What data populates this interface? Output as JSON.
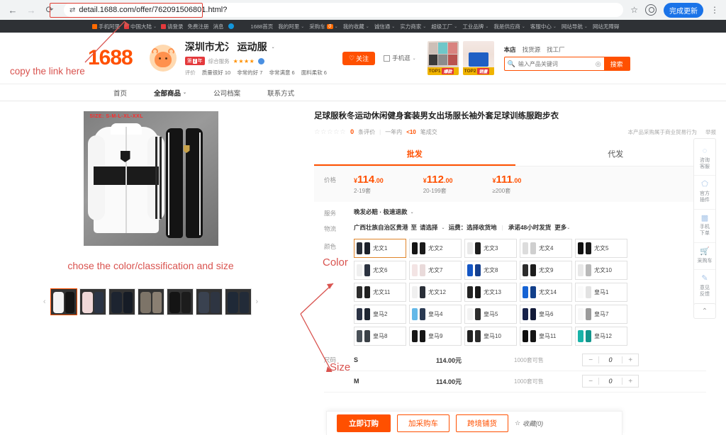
{
  "browser": {
    "back_icon": "←",
    "forward_icon": "→",
    "reload_icon": "⟳",
    "site_icon": "page-info-icon",
    "url": "detail.1688.com/offer/762091506801.html?",
    "bookmark_icon": "☆",
    "profile_icon": "avatar-icon",
    "update_label": "完成更新",
    "menu_icon": "⋮"
  },
  "topnav": {
    "left": [
      {
        "label": "手机阿里",
        "icon": "square-orange"
      },
      {
        "label": "中国大陆",
        "icon": "flag-cn",
        "caret": "⌄"
      },
      {
        "label": "请登录",
        "icon": "square-red"
      },
      {
        "label": "免费注册"
      },
      {
        "label": "消息"
      },
      {
        "label": "",
        "icon": "dot-blue"
      }
    ],
    "right": [
      {
        "label": "1688首页"
      },
      {
        "label": "我的阿里",
        "caret": "⌄"
      },
      {
        "label": "采购车",
        "badge": "0",
        "caret": "⌄"
      },
      {
        "label": "我的收藏",
        "caret": "⌄"
      },
      {
        "label": "诚信通",
        "caret": "⌄"
      },
      {
        "label": "实力商家",
        "caret": "⌄"
      },
      {
        "label": "超级工厂",
        "caret": "⌄"
      },
      {
        "label": "工业品牌",
        "caret": "⌄"
      },
      {
        "label": "我是供应商",
        "caret": "⌄"
      },
      {
        "label": "客服中心",
        "caret": "⌄"
      },
      {
        "label": "网站导航",
        "caret": "⌄"
      },
      {
        "label": "网站无障碍"
      }
    ]
  },
  "shop": {
    "logo": "1688",
    "name": "深圳市尤文运动服",
    "name_blurred": "深圳市尤氵  运动服",
    "dropdown_caret": "⌄",
    "badge_year_prefix": "第",
    "badge_year_num": "1",
    "badge_year_suffix": "年",
    "service_label": "综合服务",
    "stars": "★★★★",
    "star_partial": "★",
    "cert_icon": "verified-badge",
    "tags": [
      {
        "key": "评价",
        "value": ""
      },
      {
        "key": "",
        "value": "质量很好 10"
      },
      {
        "key": "",
        "value": "非常的好 7"
      },
      {
        "key": "",
        "value": "非常满意 6"
      },
      {
        "key": "",
        "value": "面料柔软 6"
      }
    ],
    "follow_label": "关注",
    "follow_icon": "♡",
    "mobile_label": "手机逛",
    "mobile_caret": "⌄",
    "promo_cards": [
      {
        "rank": "TOP1",
        "tag": "爆款"
      },
      {
        "rank": "TOP2",
        "tag": "销量"
      }
    ]
  },
  "search": {
    "tabs": [
      "本店",
      "找货源",
      "找工厂"
    ],
    "active_tab": "本店",
    "placeholder": "输入产品关键词",
    "value": "",
    "camera_icon": "camera-icon",
    "button_label": "搜索"
  },
  "shop_nav": {
    "items": [
      {
        "label": "首页",
        "active": false
      },
      {
        "label": "全部商品",
        "active": true,
        "caret": "⌄"
      },
      {
        "label": "公司档案",
        "active": false
      },
      {
        "label": "联系方式",
        "active": false
      }
    ]
  },
  "gallery": {
    "size_overlay": "SIZE: S-M-L-XL-XXL",
    "prev_icon": "‹",
    "next_icon": "›",
    "thumbs": [
      {
        "name": "thumb-1",
        "jacket": "#f4f4f4",
        "pants": "#1a1a1a",
        "selected": true
      },
      {
        "name": "thumb-2",
        "jacket": "#f0d8d8",
        "pants": "#2b3445",
        "selected": false
      },
      {
        "name": "thumb-3",
        "jacket": "#1d2430",
        "pants": "#161c26",
        "selected": false
      },
      {
        "name": "thumb-4",
        "jacket": "#7d7468",
        "pants": "#8a7f72",
        "selected": false
      },
      {
        "name": "thumb-5",
        "jacket": "#141414",
        "pants": "#1c1c1c",
        "selected": false
      },
      {
        "name": "thumb-6",
        "jacket": "#3a4250",
        "pants": "#2e3542",
        "selected": false
      },
      {
        "name": "thumb-7",
        "jacket": "#1f2937",
        "pants": "#222b38",
        "selected": false
      }
    ]
  },
  "product": {
    "title": "足球服秋冬运动休闲健身套装男女出场服长袖外套足球训练服跑步衣",
    "stars": "☆☆☆☆☆",
    "review_count": "0",
    "review_unit": "条评价",
    "period": "一年内",
    "deal_count": "<10",
    "deal_unit": "笔成交",
    "notice": "本产品采购属于商业贸易行为",
    "report": "举报"
  },
  "tabs": {
    "items": [
      {
        "label": "批发",
        "active": true
      },
      {
        "label": "代发",
        "active": false
      }
    ]
  },
  "price": {
    "label": "价格",
    "tiers": [
      {
        "currency": "¥",
        "amount": "114",
        "cents": ".00",
        "qty": "2-19套"
      },
      {
        "currency": "¥",
        "amount": "112",
        "cents": ".00",
        "qty": "20-199套"
      },
      {
        "currency": "¥",
        "amount": "111",
        "cents": ".00",
        "qty": "≥200套"
      }
    ]
  },
  "service": {
    "label": "服务",
    "value": "晚发必赔 · 极速退款",
    "caret": "⌄"
  },
  "logistics": {
    "label": "物流",
    "origin": "广西壮族自治区贵港",
    "to_label": "至",
    "dest_placeholder": "请选择",
    "caret": "⌄",
    "freight": "运费：选择收货地",
    "promise": "承诺48小时发货",
    "more": "更多",
    "more_caret": "⌄"
  },
  "color": {
    "label": "颜色",
    "annotation": "Color",
    "options": [
      {
        "name": "尤文1",
        "jacket": "#2a2f38",
        "pants": "#1b2029",
        "selected": true
      },
      {
        "name": "尤文2",
        "jacket": "#141414",
        "pants": "#1a1a1a",
        "selected": false
      },
      {
        "name": "尤文3",
        "jacket": "#e9e9e9",
        "pants": "#1e1e1e",
        "selected": false
      },
      {
        "name": "尤文4",
        "jacket": "#dcdcdc",
        "pants": "#cfcfcf",
        "selected": false
      },
      {
        "name": "尤文5",
        "jacket": "#101010",
        "pants": "#191919",
        "selected": false
      },
      {
        "name": "尤文6",
        "jacket": "#efefef",
        "pants": "#2c3340",
        "selected": false
      },
      {
        "name": "尤文7",
        "jacket": "#f3e4e4",
        "pants": "#e9dada",
        "selected": false
      },
      {
        "name": "尤文8",
        "jacket": "#1456c4",
        "pants": "#15408f",
        "selected": false
      },
      {
        "name": "尤文9",
        "jacket": "#2b2b2b",
        "pants": "#1d1d1d",
        "selected": false
      },
      {
        "name": "尤文10",
        "jacket": "#e8e8e8",
        "pants": "#b9b9b9",
        "selected": false
      },
      {
        "name": "尤文11",
        "jacket": "#2c2c2c",
        "pants": "#1f1f1f",
        "selected": false
      },
      {
        "name": "尤文12",
        "jacket": "#f0f0f0",
        "pants": "#2a2f38",
        "selected": false
      },
      {
        "name": "尤文13",
        "jacket": "#232323",
        "pants": "#191919",
        "selected": false
      },
      {
        "name": "尤文14",
        "jacket": "#1663d4",
        "pants": "#123f8a",
        "selected": false
      },
      {
        "name": "皇马1",
        "jacket": "#fafafa",
        "pants": "#e2e2e2",
        "selected": false
      },
      {
        "name": "皇马2",
        "jacket": "#2b3344",
        "pants": "#1e2531",
        "selected": false
      },
      {
        "name": "皇马4",
        "jacket": "#63b8e8",
        "pants": "#2a3a52",
        "selected": false
      },
      {
        "name": "皇马5",
        "jacket": "#f2f2f2",
        "pants": "#2d2d2d",
        "selected": false
      },
      {
        "name": "皇马6",
        "jacket": "#17224a",
        "pants": "#121a38",
        "selected": false
      },
      {
        "name": "皇马7",
        "jacket": "#f7f7f7",
        "pants": "#9a9a9a",
        "selected": false
      },
      {
        "name": "皇马8",
        "jacket": "#4a5158",
        "pants": "#3a4046",
        "selected": false
      },
      {
        "name": "皇马9",
        "jacket": "#171717",
        "pants": "#141414",
        "selected": false
      },
      {
        "name": "皇马10",
        "jacket": "#222222",
        "pants": "#2b2b2b",
        "selected": false
      },
      {
        "name": "皇马11",
        "jacket": "#0e0e0e",
        "pants": "#151515",
        "selected": false
      },
      {
        "name": "皇马12",
        "jacket": "#18b3a8",
        "pants": "#12958c",
        "selected": false
      }
    ]
  },
  "size": {
    "label": "尺码",
    "annotation": "Size",
    "rows": [
      {
        "name": "S",
        "price": "114.00元",
        "stock": "1000套可售",
        "qty": "0",
        "minus": "−",
        "plus": "+"
      },
      {
        "name": "M",
        "price": "114.00元",
        "stock": "1000套可售",
        "qty": "0",
        "minus": "−",
        "plus": "+"
      }
    ]
  },
  "rail": {
    "items": [
      {
        "icon": "headset-icon",
        "glyph": "◌",
        "label": "咨询\n客服"
      },
      {
        "icon": "puzzle-icon",
        "glyph": "⬠",
        "label": "官方\n插件"
      },
      {
        "icon": "qrcode-icon",
        "glyph": "▤",
        "label": "手机\n下单"
      },
      {
        "icon": "cart-icon",
        "glyph": "⛒",
        "label": "采购车"
      },
      {
        "icon": "feedback-icon",
        "glyph": "✎",
        "label": "意见\n反馈"
      }
    ],
    "scroll_top_icon": "⌃"
  },
  "action_bar": {
    "order_label": "立即订购",
    "cart_label": "加采购车",
    "cross_border_label": "跨境铺货",
    "favorite_icon": "☆",
    "favorite_label": "收藏(0)"
  },
  "annotations": {
    "copy_link": "copy the link here",
    "choose": "chose the color/classification and size",
    "color": "Color",
    "size": "Size",
    "accent_color": "#d9534f"
  }
}
